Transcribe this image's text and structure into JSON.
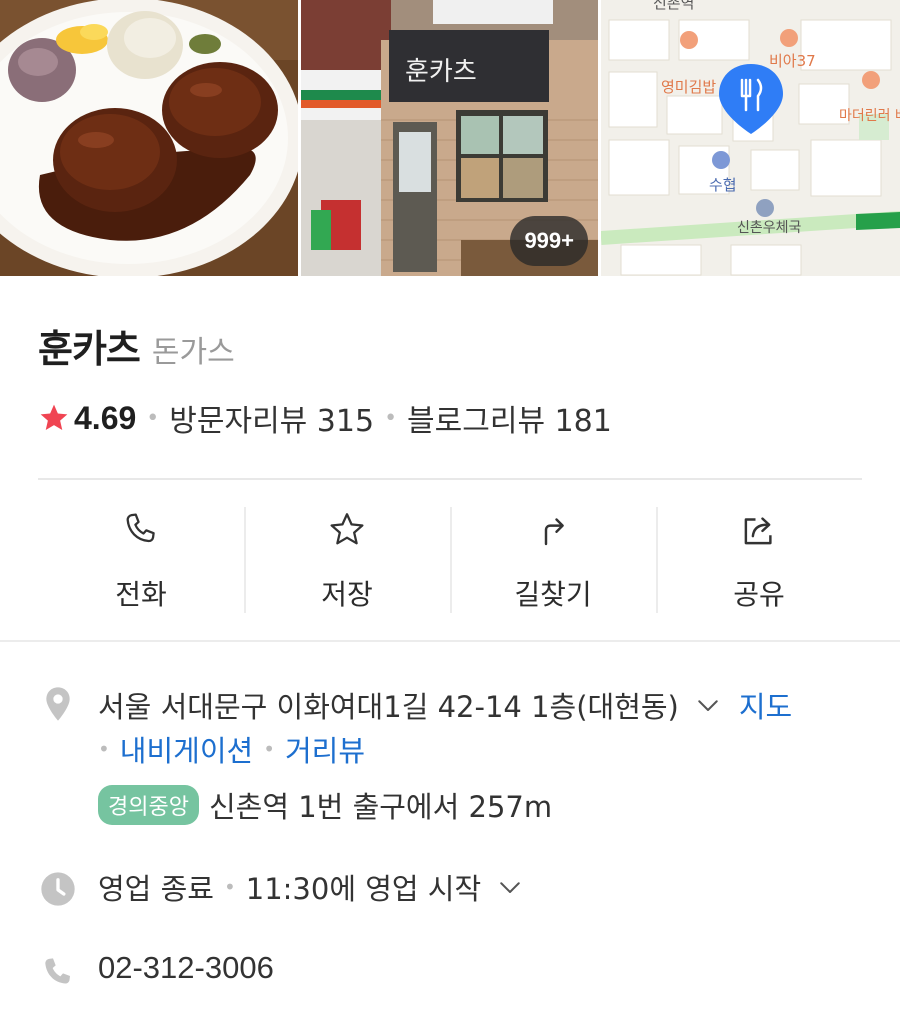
{
  "gallery": {
    "photo_count_badge": "999+"
  },
  "map_thumb": {
    "labels": {
      "station_top": "신촌역",
      "vi37": "비아37",
      "youngmi": "영미김밥",
      "madeleine": "마더린러 베이글",
      "suhyup": "수협",
      "post_office": "신촌우체국"
    }
  },
  "place": {
    "name": "훈카츠",
    "category": "돈가스",
    "rating": "4.69",
    "visitor_reviews": "방문자리뷰 315",
    "blog_reviews": "블로그리뷰 181"
  },
  "actions": [
    {
      "label": "전화"
    },
    {
      "label": "저장"
    },
    {
      "label": "길찾기"
    },
    {
      "label": "공유"
    }
  ],
  "address": {
    "text": "서울 서대문구 이화여대1길 42-14 1층(대현동)",
    "map_link": "지도",
    "nav_link": "내비게이션",
    "street_link": "거리뷰"
  },
  "subway": {
    "line": "경의중앙",
    "directions": "신촌역 1번 출구에서 257m",
    "line_color": "#76c4a0"
  },
  "hours": {
    "status": "영업 종료",
    "next": "11:30에 영업 시작"
  },
  "phone": "02-312-3006",
  "colors": {
    "accent_link": "#1d6fcf",
    "star": "#f04452"
  }
}
